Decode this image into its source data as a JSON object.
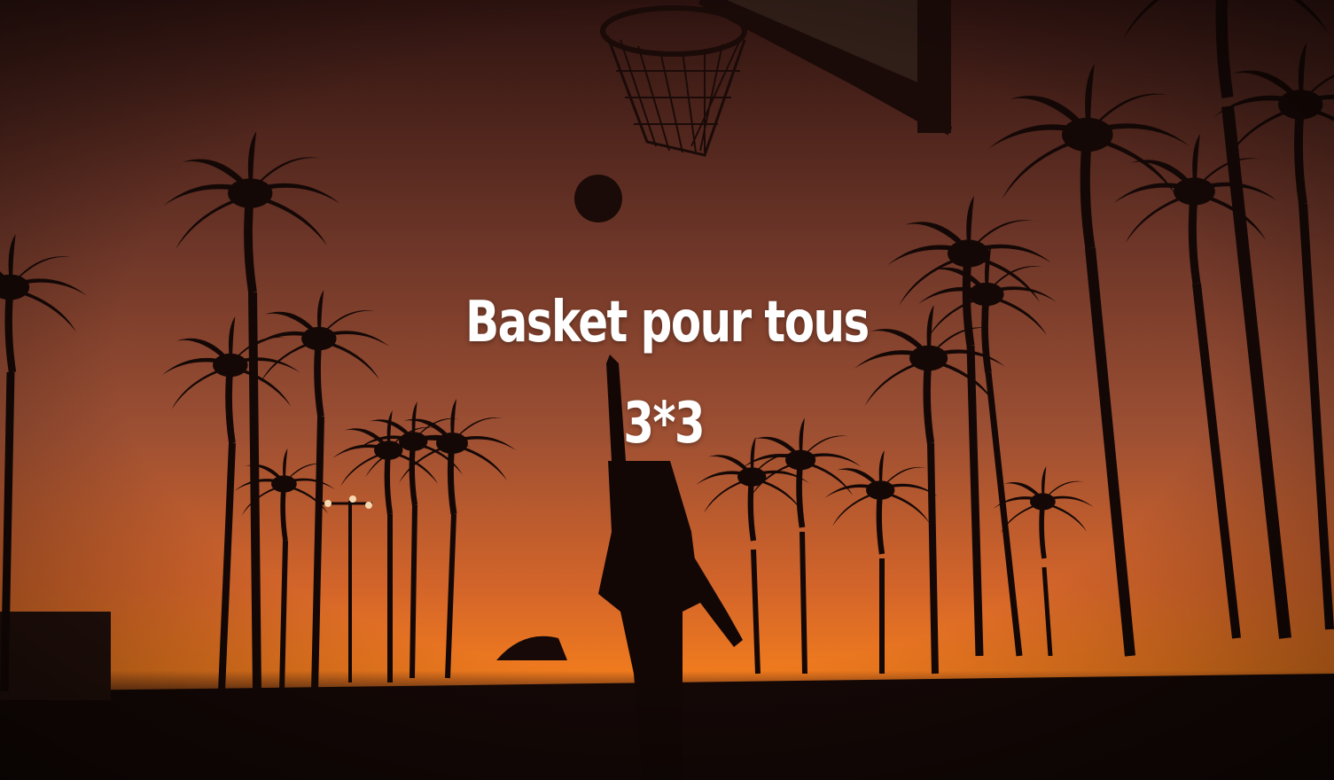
{
  "hero": {
    "title": "Basket pour tous",
    "subtitle": "3*3"
  },
  "colors": {
    "sky_top": "#3a1a14",
    "sky_mid": "#8a4a35",
    "sky_horizon": "#e86a1f",
    "silhouette": "#140806",
    "text": "#ffffff"
  },
  "icons": {
    "basketball_hoop": "basketball-hoop-silhouette",
    "ball": "basketball-silhouette",
    "player": "player-silhouette",
    "palm_trees": "palm-tree-silhouettes"
  }
}
